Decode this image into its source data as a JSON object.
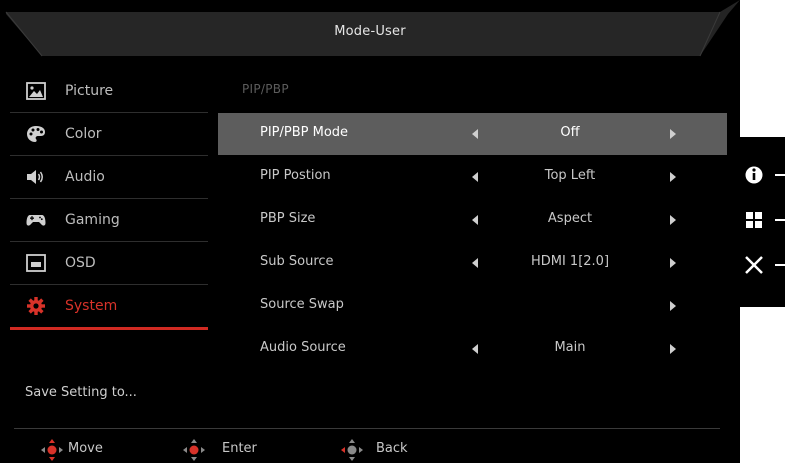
{
  "header": {
    "title": "Mode-User"
  },
  "sidebar": {
    "items": [
      {
        "label": "Picture",
        "icon": "picture-icon"
      },
      {
        "label": "Color",
        "icon": "palette-icon"
      },
      {
        "label": "Audio",
        "icon": "speaker-icon"
      },
      {
        "label": "Gaming",
        "icon": "gamepad-icon"
      },
      {
        "label": "OSD",
        "icon": "osd-window-icon"
      },
      {
        "label": "System",
        "icon": "gear-icon",
        "active": true
      }
    ],
    "save_label": "Save Setting to..."
  },
  "main": {
    "section_title": "PIP/PBP",
    "rows": [
      {
        "label": "PIP/PBP Mode",
        "value": "Off",
        "selected": true
      },
      {
        "label": "PIP Postion",
        "value": "Top Left"
      },
      {
        "label": "PBP Size",
        "value": "Aspect"
      },
      {
        "label": "Sub Source",
        "value": "HDMI 1[2.0]"
      },
      {
        "label": "Source Swap",
        "value": ""
      },
      {
        "label": "Audio Source",
        "value": "Main"
      }
    ]
  },
  "footer": {
    "move_label": "Move",
    "enter_label": "Enter",
    "back_label": "Back"
  },
  "keys": [
    "info-icon",
    "menu-grid-icon",
    "close-icon"
  ],
  "colors": {
    "accent": "#d02a22",
    "selected_row": "#5d5d5d",
    "background": "#000000"
  }
}
